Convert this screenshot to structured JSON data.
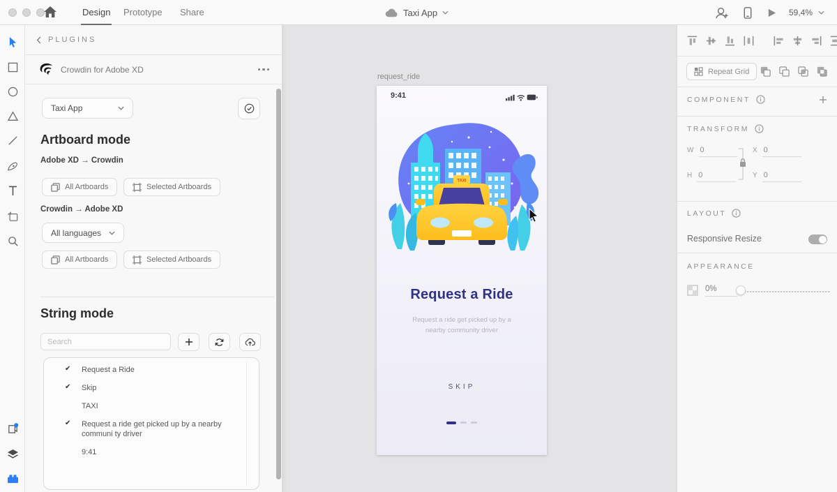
{
  "colors": {
    "xd_blue": "#2680eb",
    "title_indigo": "#2f3184",
    "taxi_yellow": "#ffc928",
    "canvas_gray": "#e4e3e5"
  },
  "topbar": {
    "tabs": {
      "design": "Design",
      "prototype": "Prototype",
      "share": "Share"
    },
    "doc_title": "Taxi App",
    "zoom_level": "59,4%"
  },
  "plugins_panel": {
    "header": "PLUGINS",
    "plugin_name": "Crowdin for Adobe XD",
    "project_select": "Taxi App",
    "artboard_mode": {
      "title": "Artboard mode",
      "xd_to_crowdin": "Adobe XD → Crowdin",
      "crowdin_to_xd": "Crowdin → Adobe XD",
      "all_artboards": "All Artboards",
      "selected_artboards": "Selected Artboards",
      "languages_select": "All languages"
    },
    "string_mode": {
      "title": "String mode",
      "search_placeholder": "Search",
      "strings": [
        {
          "check": "✔",
          "text": "Request a Ride"
        },
        {
          "check": "✔",
          "text": "Skip"
        },
        {
          "check": "",
          "text": "TAXI"
        },
        {
          "check": "✔",
          "text": "Request a ride get picked up by a nearby communi ty driver"
        },
        {
          "check": "",
          "text": "9:41"
        }
      ]
    }
  },
  "canvas": {
    "artboard_name": "request_ride",
    "phone": {
      "time": "9:41",
      "taxi_sign": "TAXI",
      "title": "Request a Ride",
      "subtitle": "Request a ride get picked up by a nearby community driver",
      "skip_button": "SKIP"
    }
  },
  "right_panel": {
    "repeat_grid_label": "Repeat Grid",
    "component_label": "COMPONENT",
    "transform_label": "TRANSFORM",
    "layout_label": "LAYOUT",
    "appearance_label": "APPEARANCE",
    "responsive_resize_label": "Responsive Resize",
    "transform": {
      "w_label": "W",
      "h_label": "H",
      "x_label": "X",
      "y_label": "Y",
      "w_value": "0",
      "h_value": "0",
      "x_value": "0",
      "y_value": "0"
    },
    "opacity_value": "0%"
  }
}
